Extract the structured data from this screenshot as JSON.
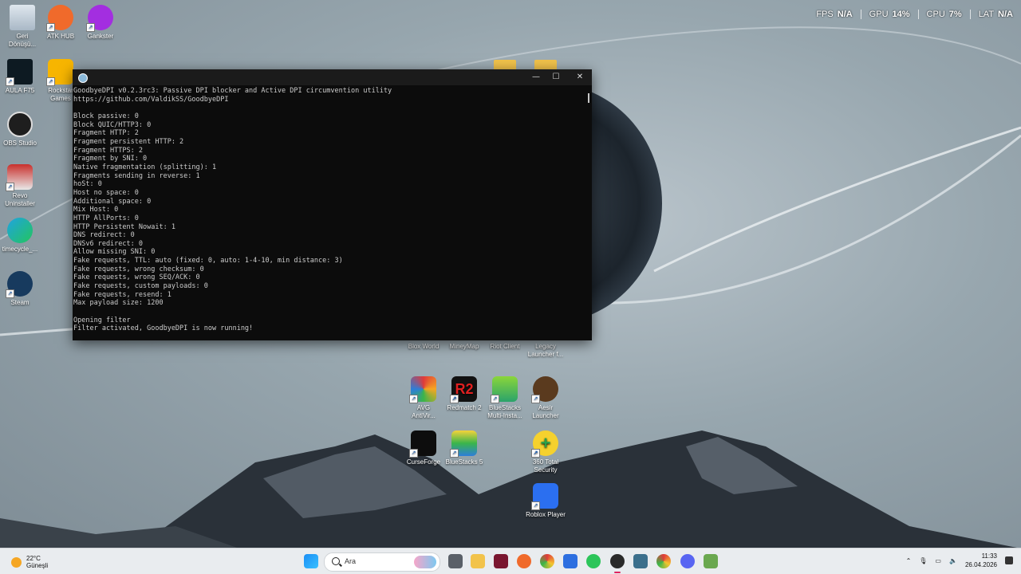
{
  "perf": {
    "fps_label": "FPS",
    "fps_value": "N/A",
    "gpu_label": "GPU",
    "gpu_value": "14%",
    "cpu_label": "CPU",
    "cpu_value": "7%",
    "lat_label": "LAT",
    "lat_value": "N/A"
  },
  "desktop_icons": {
    "recycle": "Geri\nDönüşü...",
    "atkhub": "ATK HUB",
    "gankster": "Gankster",
    "aula": "AULA F75",
    "rockstar": "Rockstar\nGames",
    "obs": "OBS Studio",
    "revo": "Revo\nUninstaller",
    "timecycle": "timecycle_...",
    "steam": "Steam",
    "bloxworld": "Blox World",
    "mineymap": "MineyMap",
    "riot": "Riot Client",
    "legacy": "Legacy\nLauncher f...",
    "avg": "AVG\nAntiVir...",
    "redmatch": "Redmatch 2",
    "bluestacks_multi": "BlueStacks\nMulti-Insta...",
    "aesir": "Aesir\nLauncher",
    "curseforge": "CurseForge",
    "bluestacks5": "BlueStacks 5",
    "total360": "360 Total\nSecurity",
    "roblox": "Roblox Player"
  },
  "terminal": {
    "lines": [
      "GoodbyeDPI v0.2.3rc3: Passive DPI blocker and Active DPI circumvention utility",
      "https://github.com/ValdikSS/GoodbyeDPI",
      "",
      "Block passive: 0",
      "Block QUIC/HTTP3: 0",
      "Fragment HTTP: 2",
      "Fragment persistent HTTP: 2",
      "Fragment HTTPS: 2",
      "Fragment by SNI: 0",
      "Native fragmentation (splitting): 1",
      "Fragments sending in reverse: 1",
      "hoSt: 0",
      "Host no space: 0",
      "Additional space: 0",
      "Mix Host: 0",
      "HTTP AllPorts: 0",
      "HTTP Persistent Nowait: 1",
      "DNS redirect: 0",
      "DNSv6 redirect: 0",
      "Allow missing SNI: 0",
      "Fake requests, TTL: auto (fixed: 0, auto: 1-4-10, min distance: 3)",
      "Fake requests, wrong checksum: 0",
      "Fake requests, wrong SEQ/ACK: 0",
      "Fake requests, custom payloads: 0",
      "Fake requests, resend: 1",
      "Max payload size: 1200",
      "",
      "Opening filter",
      "Filter activated, GoodbyeDPI is now running!"
    ],
    "minimize": "—",
    "maximize": "☐",
    "close": "✕"
  },
  "taskbar": {
    "temperature": "22°C",
    "condition": "Güneşli",
    "search_placeholder": "Ara",
    "time": "11:33",
    "date": "26.04.2026"
  }
}
